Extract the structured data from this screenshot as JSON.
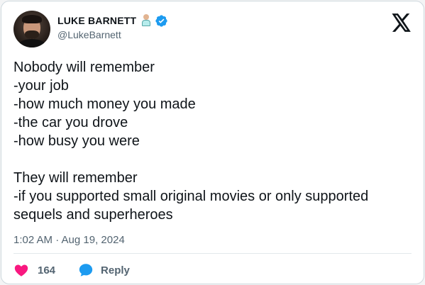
{
  "tweet": {
    "author": {
      "display_name": "LUKE BARNETT",
      "handle": "@LukeBarnett",
      "name_emoji_icon": "person-technologist-emoji-icon",
      "verified_icon": "verified-badge-icon"
    },
    "platform_logo": "x-logo-icon",
    "text": "Nobody will remember\n-your job\n-how much money you made\n-the car you drove\n-how busy you were\n\nThey will remember\n-if you supported small original movies or only supported sequels and superheroes",
    "timestamp": "1:02 AM · Aug 19, 2024",
    "actions": {
      "like_count": "164",
      "reply_label": "Reply"
    }
  },
  "colors": {
    "text": "#0f1419",
    "muted": "#536471",
    "like": "#f91880",
    "reply": "#1d9bf0",
    "verified": "#1d9bf0",
    "border": "#cfd9de"
  }
}
